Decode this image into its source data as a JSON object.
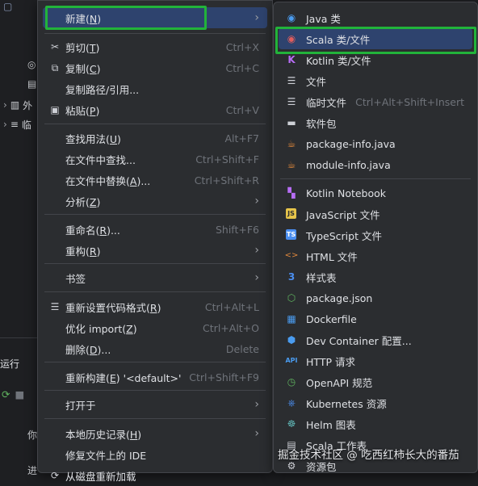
{
  "ide": {
    "tree_rows": [
      {
        "icon": "folder-icon",
        "glyph": "▢",
        "label": ""
      },
      {
        "icon": "class-icon",
        "glyph": "◎",
        "label": ""
      },
      {
        "icon": "file-icon",
        "glyph": "▤",
        "label": ""
      },
      {
        "icon": "library-icon",
        "glyph": "▥",
        "label": "外"
      },
      {
        "icon": "scratch-icon",
        "glyph": "≡",
        "label": "临"
      }
    ],
    "panel_title": "运行",
    "text_fragments": [
      "你",
      "进"
    ]
  },
  "context_menu": {
    "items": [
      {
        "type": "item",
        "label": "新建(N)",
        "shortcut": "",
        "submenu": true,
        "icon": "",
        "selected": true
      },
      {
        "type": "sep"
      },
      {
        "type": "item",
        "label": "剪切(T)",
        "shortcut": "Ctrl+X",
        "icon": "scissors-icon",
        "glyph": "✂"
      },
      {
        "type": "item",
        "label": "复制(C)",
        "shortcut": "Ctrl+C",
        "icon": "copy-icon",
        "glyph": "⧉"
      },
      {
        "type": "item",
        "label": "复制路径/引用...",
        "shortcut": "",
        "icon": ""
      },
      {
        "type": "item",
        "label": "粘贴(P)",
        "shortcut": "Ctrl+V",
        "icon": "paste-icon",
        "glyph": "▣"
      },
      {
        "type": "sep"
      },
      {
        "type": "item",
        "label": "查找用法(U)",
        "shortcut": "Alt+F7",
        "icon": ""
      },
      {
        "type": "item",
        "label": "在文件中查找...",
        "shortcut": "Ctrl+Shift+F",
        "icon": ""
      },
      {
        "type": "item",
        "label": "在文件中替换(A)...",
        "shortcut": "Ctrl+Shift+R",
        "icon": ""
      },
      {
        "type": "item",
        "label": "分析(Z)",
        "shortcut": "",
        "submenu": true,
        "icon": ""
      },
      {
        "type": "sep"
      },
      {
        "type": "item",
        "label": "重命名(R)...",
        "shortcut": "Shift+F6",
        "icon": ""
      },
      {
        "type": "item",
        "label": "重构(R)",
        "shortcut": "",
        "submenu": true,
        "icon": ""
      },
      {
        "type": "sep"
      },
      {
        "type": "item",
        "label": "书签",
        "shortcut": "",
        "submenu": true,
        "icon": ""
      },
      {
        "type": "sep"
      },
      {
        "type": "item",
        "label": "重新设置代码格式(R)",
        "shortcut": "Ctrl+Alt+L",
        "icon": "reformat-icon",
        "glyph": "☰"
      },
      {
        "type": "item",
        "label": "优化 import(Z)",
        "shortcut": "Ctrl+Alt+O",
        "icon": ""
      },
      {
        "type": "item",
        "label": "删除(D)...",
        "shortcut": "Delete",
        "icon": ""
      },
      {
        "type": "sep"
      },
      {
        "type": "item",
        "label": "重新构建(E) '<default>'",
        "shortcut": "Ctrl+Shift+F9",
        "icon": ""
      },
      {
        "type": "sep"
      },
      {
        "type": "item",
        "label": "打开于",
        "shortcut": "",
        "submenu": true,
        "icon": ""
      },
      {
        "type": "sep"
      },
      {
        "type": "item",
        "label": "本地历史记录(H)",
        "shortcut": "",
        "submenu": true,
        "icon": ""
      },
      {
        "type": "item",
        "label": "修复文件上的 IDE",
        "shortcut": "",
        "icon": ""
      },
      {
        "type": "item",
        "label": "从磁盘重新加载",
        "shortcut": "",
        "icon": "reload-icon",
        "glyph": "⟳"
      }
    ]
  },
  "new_submenu": {
    "items": [
      {
        "type": "item",
        "label": "Java 类",
        "shortcut": "",
        "icon": "java-class-icon",
        "glyph": "●",
        "color": "#4a9cf0"
      },
      {
        "type": "item",
        "label": "Scala 类/文件",
        "shortcut": "",
        "icon": "scala-class-icon",
        "glyph": "●",
        "color": "#e05d5d",
        "selected": true
      },
      {
        "type": "item",
        "label": "Kotlin 类/文件",
        "shortcut": "",
        "icon": "kotlin-file-icon",
        "glyph": "K",
        "color": "#b76df5"
      },
      {
        "type": "item",
        "label": "文件",
        "shortcut": "",
        "icon": "file-icon",
        "glyph": "☰",
        "color": "#ced0d6"
      },
      {
        "type": "item",
        "label": "临时文件",
        "shortcut": "Ctrl+Alt+Shift+Insert",
        "icon": "scratch-file-icon",
        "glyph": "☰",
        "color": "#ced0d6"
      },
      {
        "type": "item",
        "label": "软件包",
        "shortcut": "",
        "icon": "package-icon",
        "glyph": "▬",
        "color": "#ced0d6"
      },
      {
        "type": "item",
        "label": "package-info.java",
        "shortcut": "",
        "icon": "java-file-icon",
        "glyph": "☕",
        "color": "#e0883c"
      },
      {
        "type": "item",
        "label": "module-info.java",
        "shortcut": "",
        "icon": "java-file-icon",
        "glyph": "☕",
        "color": "#e0883c"
      },
      {
        "type": "sep"
      },
      {
        "type": "item",
        "label": "Kotlin Notebook",
        "shortcut": "",
        "icon": "kotlin-notebook-icon",
        "glyph": "▚",
        "color": "#b76df5"
      },
      {
        "type": "item",
        "label": "JavaScript 文件",
        "shortcut": "",
        "icon": "javascript-icon",
        "glyph": "JS",
        "color": "#e6c44a"
      },
      {
        "type": "item",
        "label": "TypeScript 文件",
        "shortcut": "",
        "icon": "typescript-icon",
        "glyph": "TS",
        "color": "#4a8ef0"
      },
      {
        "type": "item",
        "label": "HTML 文件",
        "shortcut": "",
        "icon": "html-icon",
        "glyph": "<>",
        "color": "#e0883c"
      },
      {
        "type": "item",
        "label": "样式表",
        "shortcut": "",
        "icon": "css-icon",
        "glyph": "3",
        "color": "#4a8ef0"
      },
      {
        "type": "item",
        "label": "package.json",
        "shortcut": "",
        "icon": "nodejs-icon",
        "glyph": "⬡",
        "color": "#5fb35f"
      },
      {
        "type": "item",
        "label": "Dockerfile",
        "shortcut": "",
        "icon": "docker-icon",
        "glyph": "▦",
        "color": "#4a9cf0"
      },
      {
        "type": "item",
        "label": "Dev Container 配置...",
        "shortcut": "",
        "icon": "dev-container-icon",
        "glyph": "⬢",
        "color": "#4a9cf0"
      },
      {
        "type": "item",
        "label": "HTTP 请求",
        "shortcut": "",
        "icon": "http-api-icon",
        "glyph": "API",
        "color": "#4a9cf0"
      },
      {
        "type": "item",
        "label": "OpenAPI 规范",
        "shortcut": "",
        "icon": "openapi-icon",
        "glyph": "◷",
        "color": "#5fb35f"
      },
      {
        "type": "item",
        "label": "Kubernetes 资源",
        "shortcut": "",
        "icon": "kubernetes-icon",
        "glyph": "⎈",
        "color": "#4a8ef0"
      },
      {
        "type": "item",
        "label": "Helm 图表",
        "shortcut": "",
        "icon": "helm-icon",
        "glyph": "☸",
        "color": "#5fb3b3"
      },
      {
        "type": "item",
        "label": "Scala 工作表",
        "shortcut": "",
        "icon": "scala-worksheet-icon",
        "glyph": "▤",
        "color": "#ced0d6"
      },
      {
        "type": "item",
        "label": "资源包",
        "shortcut": "",
        "icon": "resource-bundle-icon",
        "glyph": "⚙",
        "color": "#ced0d6"
      }
    ]
  },
  "highlight_color": "#22b33a",
  "watermark": "掘金技术社区 @ 吃西红柿长大的番茄"
}
